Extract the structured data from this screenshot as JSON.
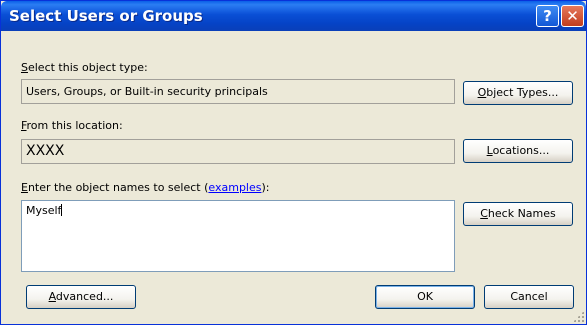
{
  "window": {
    "title": "Select Users or Groups",
    "help_label": "?",
    "close_label": "✕"
  },
  "object_type": {
    "label_prefix": "",
    "label_accel": "S",
    "label_rest": "elect this object type:",
    "value": "Users, Groups, or Built-in security principals",
    "button_accel": "O",
    "button_rest": "bject Types..."
  },
  "location": {
    "label_accel": "F",
    "label_rest": "rom this location:",
    "value": "XXXX",
    "button_accel": "L",
    "button_rest": "ocations..."
  },
  "names": {
    "label_accel": "E",
    "label_rest": "nter the object names to select (",
    "examples_link": "examples",
    "label_end": "):",
    "value": "Myself",
    "check_accel": "C",
    "check_rest": "heck Names"
  },
  "footer": {
    "advanced_accel": "A",
    "advanced_rest": "dvanced...",
    "ok_label": "OK",
    "cancel_label": "Cancel"
  },
  "colors": {
    "titlebar": "#0a4fd6",
    "dialog_bg": "#ece9d8",
    "link": "#0000ff",
    "close": "#c23d1d"
  }
}
